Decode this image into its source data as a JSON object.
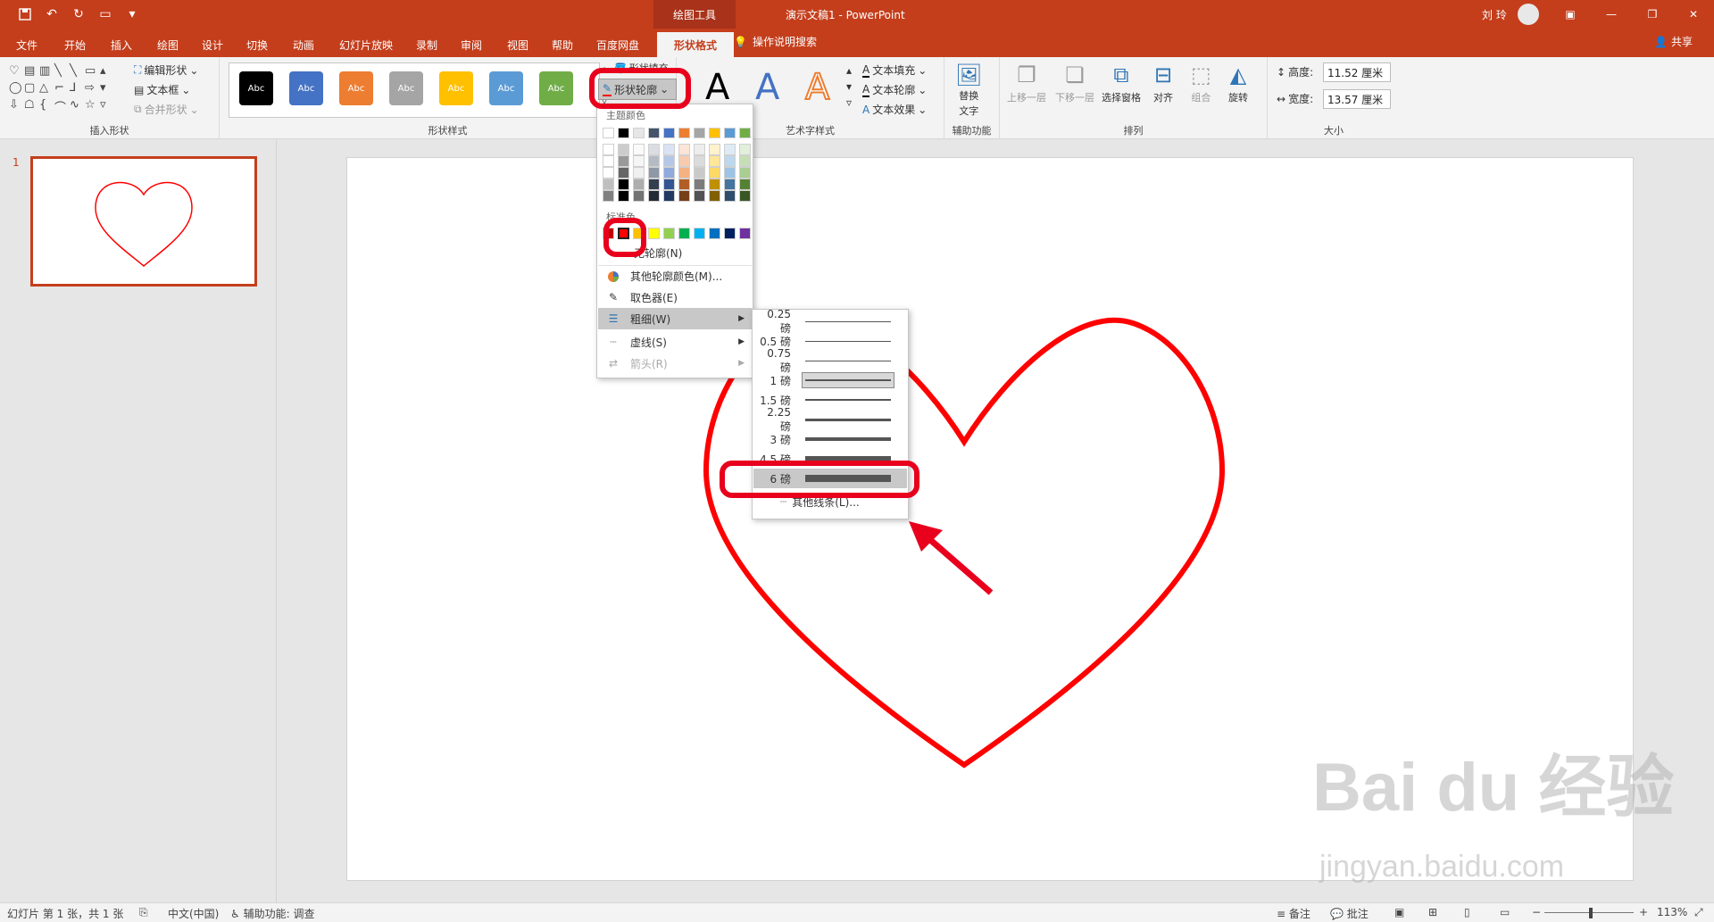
{
  "titlebar": {
    "context_tab": "绘图工具",
    "doc_title": "演示文稿1 - PowerPoint",
    "user": "刘 玲"
  },
  "tabs": [
    "文件",
    "开始",
    "插入",
    "绘图",
    "设计",
    "切换",
    "动画",
    "幻灯片放映",
    "录制",
    "审阅",
    "视图",
    "帮助",
    "百度网盘",
    "形状格式"
  ],
  "active_tab": "形状格式",
  "tellme": "操作说明搜索",
  "share": "共享",
  "ribbon": {
    "insert_shapes": {
      "label": "插入形状",
      "edit_shape": "编辑形状",
      "text_box": "文本框",
      "merge_shapes": "合并形状"
    },
    "shape_styles": {
      "label": "形状样式",
      "sample": "Abc",
      "fill_partial": "形状填充",
      "outline_button": "形状轮廓",
      "colors": [
        "#000000",
        "#4472c4",
        "#ed7d31",
        "#a5a5a5",
        "#ffc000",
        "#5b9bd5",
        "#70ad47"
      ]
    },
    "wordart": {
      "label": "艺术字样式",
      "glyph": "A",
      "text_fill": "文本填充",
      "text_outline": "文本轮廓",
      "text_effects": "文本效果"
    },
    "accessibility": {
      "label": "辅助功能",
      "alt_text_line1": "替换",
      "alt_text_line2": "文字"
    },
    "arrange": {
      "label": "排列",
      "bring_forward": "上移一层",
      "send_backward": "下移一层",
      "selection_pane": "选择窗格",
      "align": "对齐",
      "group": "组合",
      "rotate": "旋转"
    },
    "size": {
      "label": "大小",
      "height_label": "高度:",
      "height_value": "11.52 厘米",
      "width_label": "宽度:",
      "width_value": "13.57 厘米"
    }
  },
  "thumbnail": {
    "number": "1"
  },
  "outline_menu": {
    "theme_colors_header": "主题颜色",
    "standard_colors_header": "标准色",
    "no_outline": "无轮廓(N)",
    "more_colors": "其他轮廓颜色(M)...",
    "eyedropper": "取色器(E)",
    "weight": "粗细(W)",
    "dashes": "虚线(S)",
    "arrows": "箭头(R)",
    "theme_colors": [
      "#ffffff",
      "#000000",
      "#e7e6e6",
      "#44546a",
      "#4472c4",
      "#ed7d31",
      "#a5a5a5",
      "#ffc000",
      "#5b9bd5",
      "#70ad47"
    ],
    "standard_colors": [
      "#c00000",
      "#ff0000",
      "#ffc000",
      "#ffff00",
      "#92d050",
      "#00b050",
      "#00b0f0",
      "#0070c0",
      "#002060",
      "#7030a0"
    ]
  },
  "weight_menu": {
    "items": [
      "0.25 磅",
      "0.5 磅",
      "0.75 磅",
      "1 磅",
      "1.5 磅",
      "2.25 磅",
      "3 磅",
      "4.5 磅",
      "6 磅"
    ],
    "selected": "1 磅",
    "highlighted": "6 磅",
    "more_lines": "其他线条(L)..."
  },
  "statusbar": {
    "slide_info": "幻灯片 第 1 张，共 1 张",
    "language": "中文(中国)",
    "accessibility": "辅助功能: 调查",
    "notes": "备注",
    "comments": "批注",
    "zoom": "113%"
  },
  "shape": {
    "type": "heart",
    "outline_color": "#ff0000"
  },
  "watermark": {
    "text": "Bai du 经验",
    "sub": "jingyan.baidu.com"
  }
}
